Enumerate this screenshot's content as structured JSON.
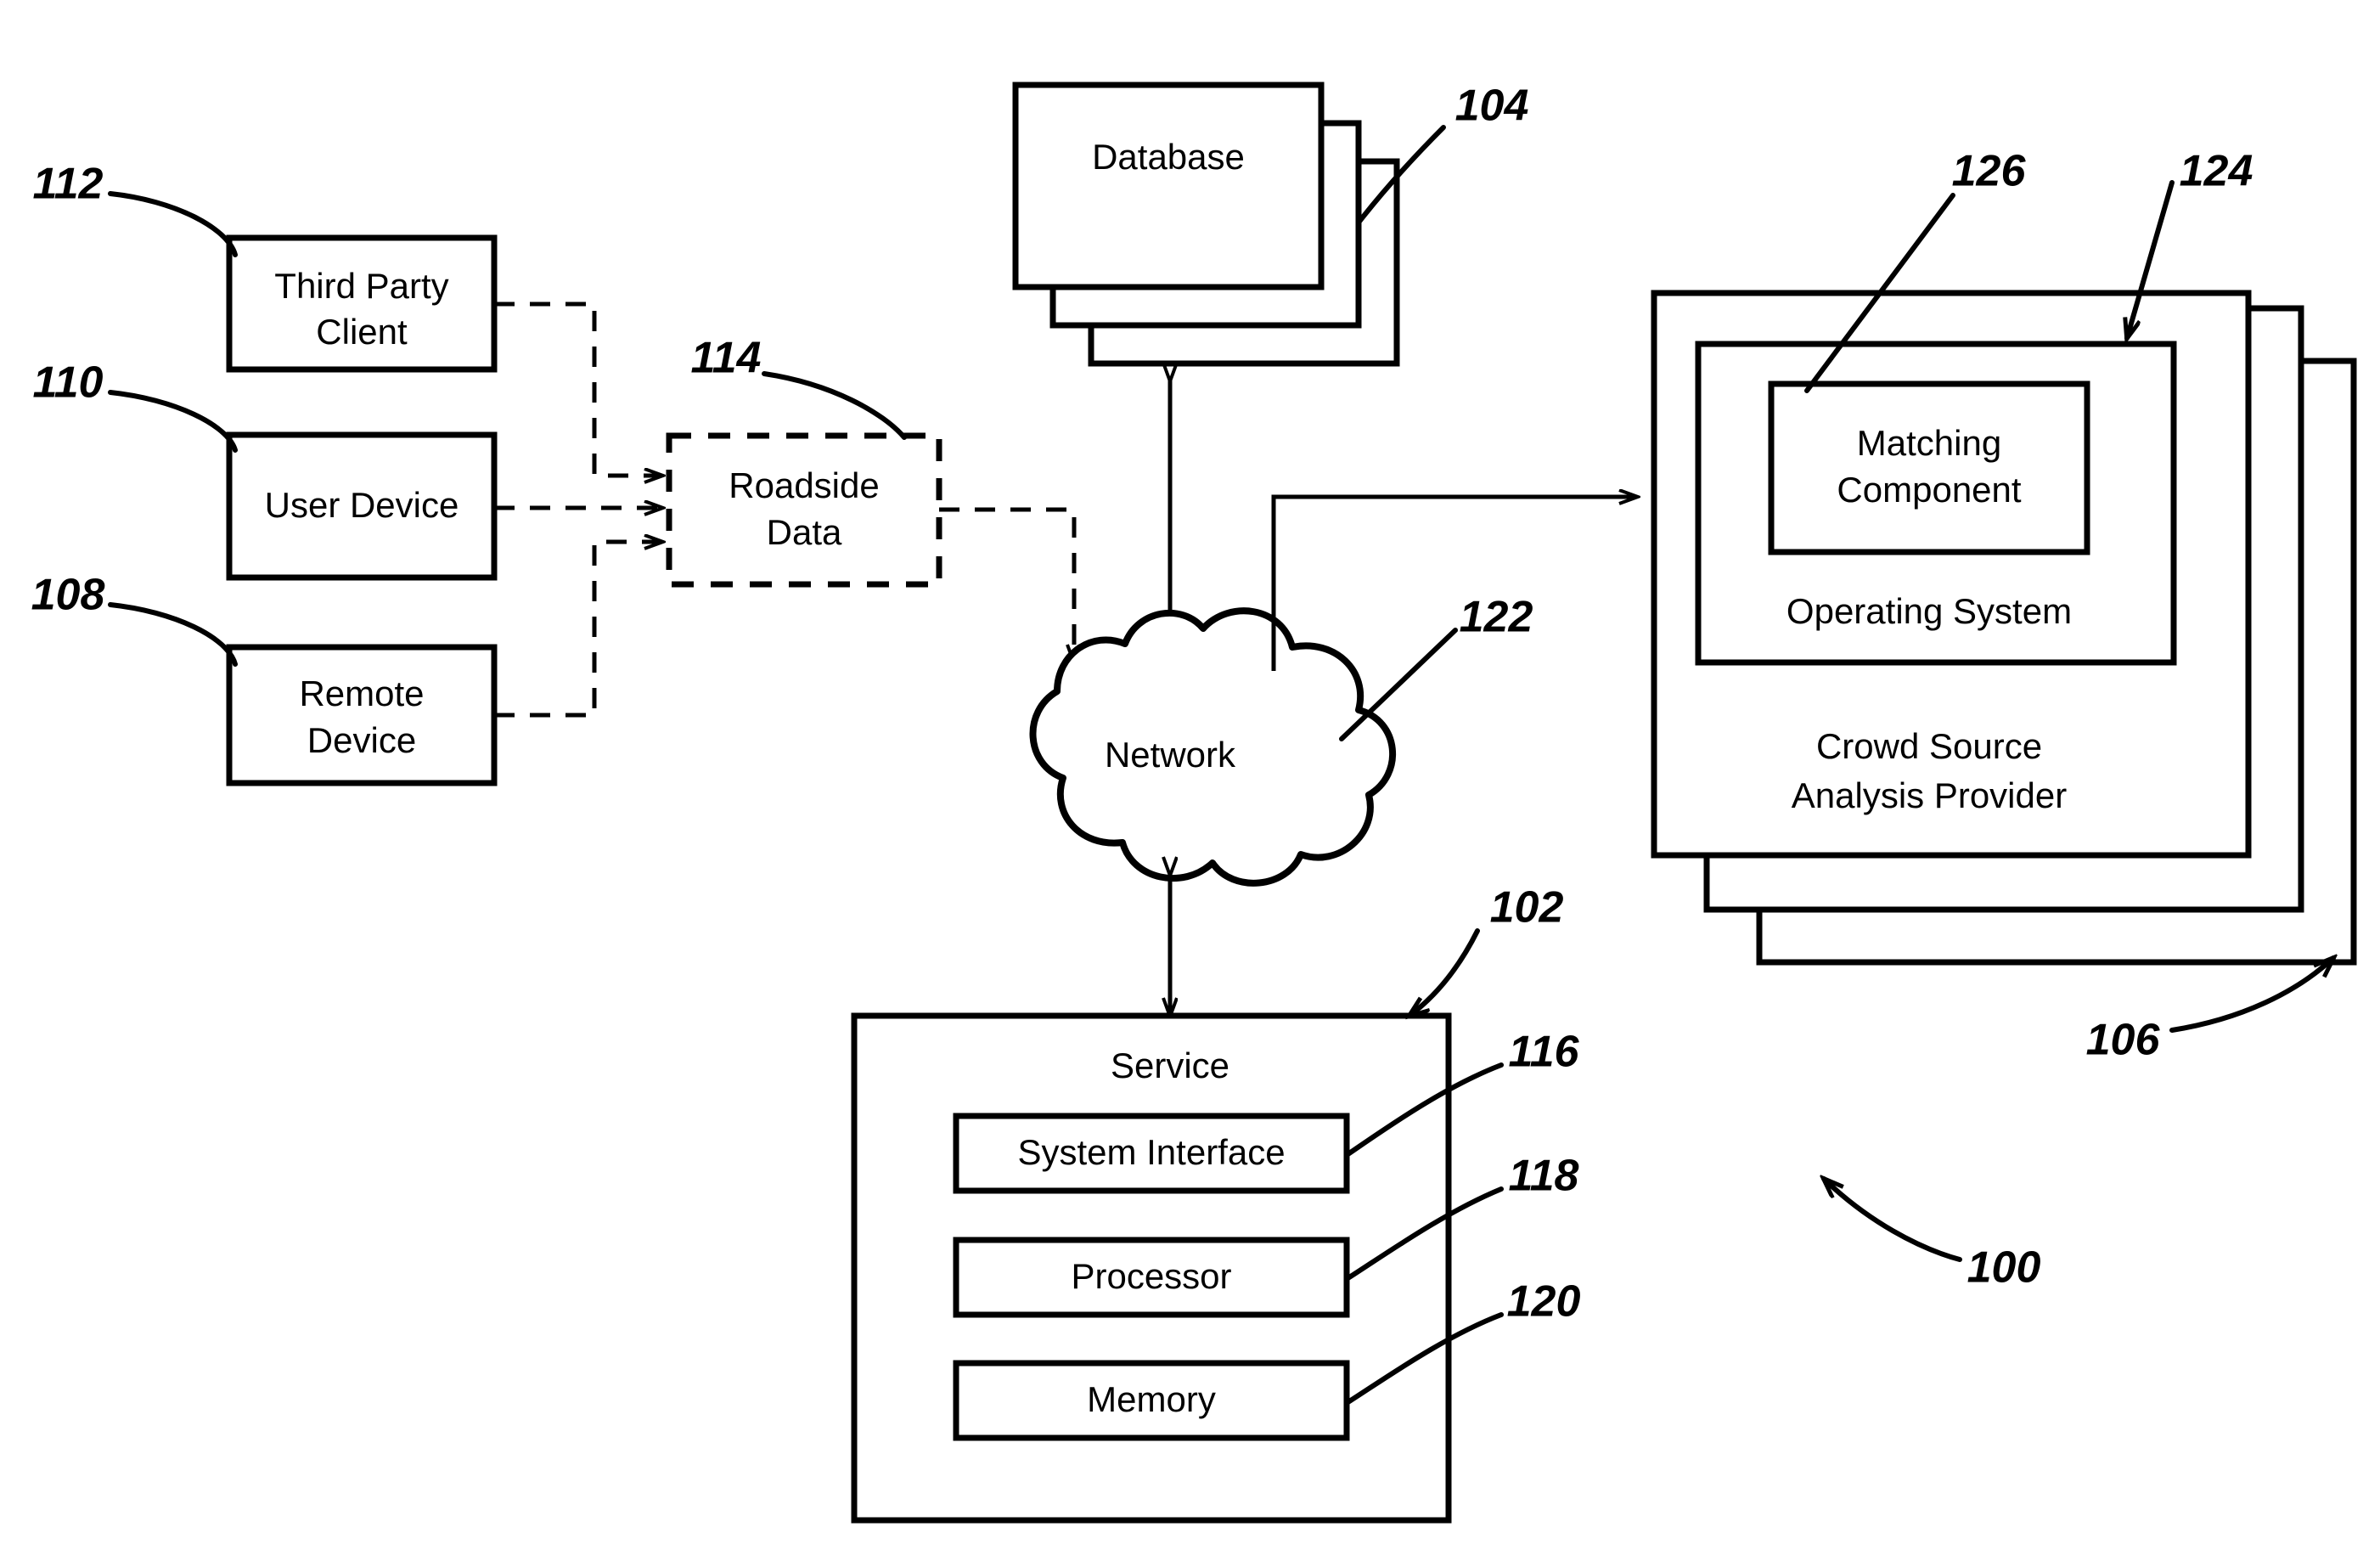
{
  "figure": {
    "type": "patent-block-diagram",
    "overall_reference": "100"
  },
  "nodes": {
    "third_party_client": {
      "label_line1": "Third Party",
      "label_line2": "Client",
      "ref": "112"
    },
    "user_device": {
      "label": "User Device",
      "ref": "110"
    },
    "remote_device": {
      "label_line1": "Remote",
      "label_line2": "Device",
      "ref": "108"
    },
    "roadside_data": {
      "label_line1": "Roadside",
      "label_line2": "Data",
      "ref": "114",
      "style": "dashed"
    },
    "database": {
      "label": "Database",
      "ref": "104",
      "stacked_count": 3
    },
    "network": {
      "label": "Network",
      "ref": "122",
      "shape": "cloud"
    },
    "crowd_source": {
      "label_line1": "Crowd Source",
      "label_line2": "Analysis Provider",
      "ref": "106",
      "stacked_count": 3
    },
    "operating_system": {
      "label": "Operating System",
      "ref": "124"
    },
    "matching_component": {
      "label_line1": "Matching",
      "label_line2": "Component",
      "ref": "126"
    },
    "service": {
      "label": "Service",
      "ref": "102"
    },
    "system_interface": {
      "label": "System Interface",
      "ref": "116"
    },
    "processor": {
      "label": "Processor",
      "ref": "118"
    },
    "memory": {
      "label": "Memory",
      "ref": "120"
    }
  },
  "reference_numerals": {
    "n100": "100",
    "n102": "102",
    "n104": "104",
    "n106": "106",
    "n108": "108",
    "n110": "110",
    "n112": "112",
    "n114": "114",
    "n116": "116",
    "n118": "118",
    "n120": "120",
    "n122": "122",
    "n124": "124",
    "n126": "126"
  },
  "colors": {
    "stroke": "#000000",
    "fill": "#ffffff"
  }
}
